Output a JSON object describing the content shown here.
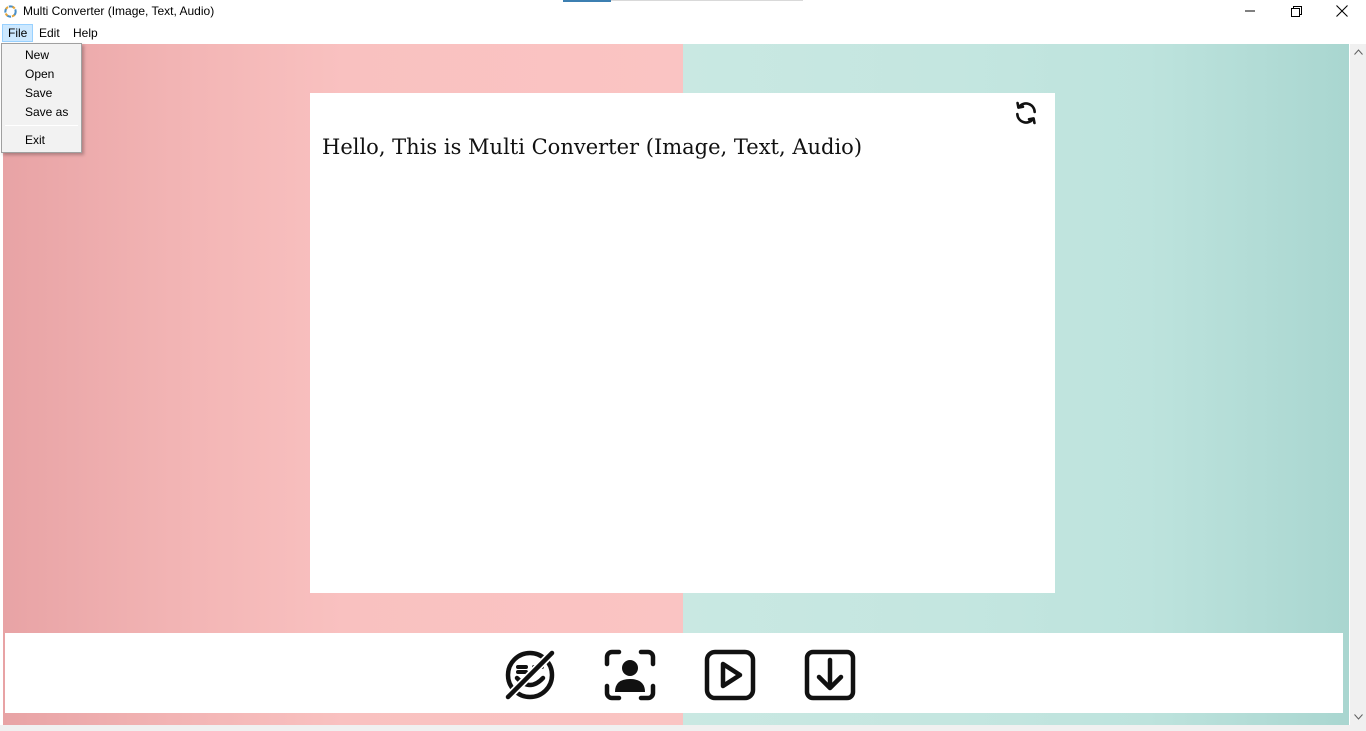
{
  "window": {
    "title": "Multi Converter (Image, Text, Audio)",
    "controls": {
      "minimize_icon": "minimize-icon",
      "maximize_icon": "restore-icon",
      "close_icon": "close-icon"
    }
  },
  "menubar": {
    "items": [
      {
        "label": "File",
        "active": true
      },
      {
        "label": "Edit"
      },
      {
        "label": "Help"
      }
    ]
  },
  "file_menu": {
    "items": [
      "New",
      "Open",
      "Save",
      "Save as"
    ],
    "exit_label": "Exit"
  },
  "panel": {
    "text": "Hello, This is Multi Converter (Image, Text, Audio)",
    "refresh_icon": "refresh-icon"
  },
  "toolbar": {
    "buttons": [
      {
        "icon": "emoji-off-icon"
      },
      {
        "icon": "face-scan-icon"
      },
      {
        "icon": "play-icon"
      },
      {
        "icon": "download-icon"
      }
    ]
  },
  "colors": {
    "left_background": "#f7bcbc",
    "right_background": "#c2e5df",
    "menu_highlight": "#cce8ff"
  }
}
